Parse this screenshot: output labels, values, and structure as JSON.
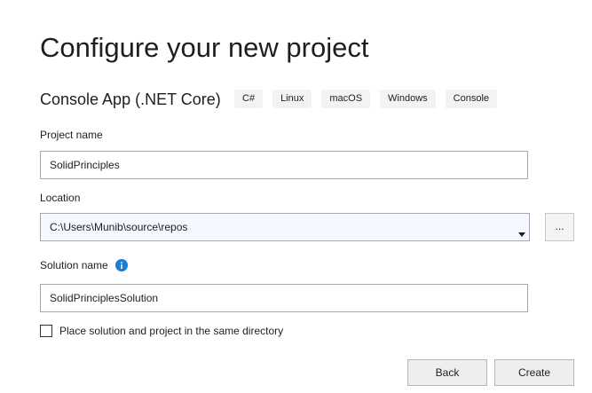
{
  "header": {
    "title": "Configure your new project",
    "subtitle": "Console App (.NET Core)",
    "tags": [
      "C#",
      "Linux",
      "macOS",
      "Windows",
      "Console"
    ]
  },
  "form": {
    "project_name": {
      "label": "Project name",
      "value": "SolidPrinciples"
    },
    "location": {
      "label": "Location",
      "value": "C:\\Users\\Munib\\source\\repos",
      "browse_label": "..."
    },
    "solution_name": {
      "label": "Solution name",
      "value": "SolidPrinciplesSolution"
    },
    "same_directory": {
      "label": "Place solution and project in the same directory",
      "checked": false
    }
  },
  "footer": {
    "back_label": "Back",
    "create_label": "Create"
  },
  "colors": {
    "info_icon": "#1c7dd6",
    "dropdown_bg": "#f4f7ff"
  }
}
